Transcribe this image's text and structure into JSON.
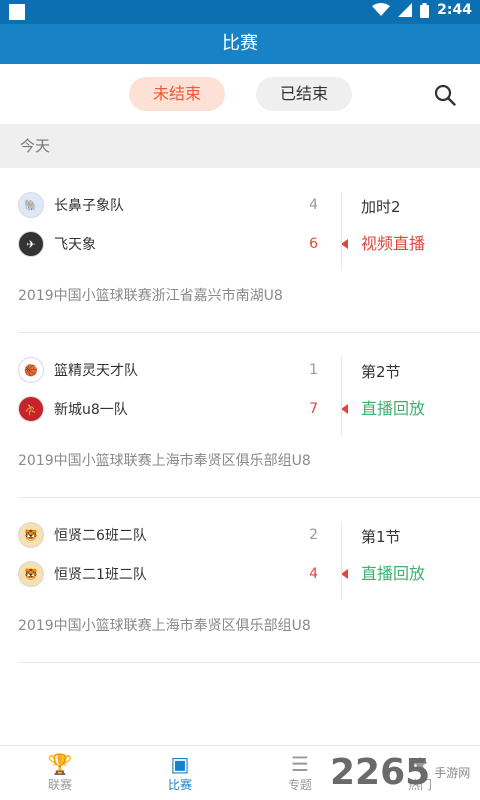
{
  "status_bar": {
    "time": "2:44"
  },
  "app_bar": {
    "title": "比赛"
  },
  "tabs": {
    "ongoing": "未结束",
    "finished": "已结束"
  },
  "day_header": "今天",
  "matches": [
    {
      "home": {
        "name": "长鼻子象队",
        "score": "4"
      },
      "away": {
        "name": "飞天象",
        "score": "6"
      },
      "status": "加时2",
      "live": "视频直播",
      "league": "2019中国小篮球联赛浙江省嘉兴市南湖U8"
    },
    {
      "home": {
        "name": "篮精灵天才队",
        "score": "1"
      },
      "away": {
        "name": "新城u8一队",
        "score": "7"
      },
      "status": "第2节",
      "live": "直播回放",
      "league": "2019中国小篮球联赛上海市奉贤区俱乐部组U8"
    },
    {
      "home": {
        "name": "恒贤二6班二队",
        "score": "2"
      },
      "away": {
        "name": "恒贤二1班二队",
        "score": "4"
      },
      "status": "第1节",
      "live": "直播回放",
      "league": "2019中国小篮球联赛上海市奉贤区俱乐部组U8"
    }
  ],
  "bottom_nav": [
    {
      "label": "联赛",
      "icon": "trophy-icon"
    },
    {
      "label": "比赛",
      "icon": "match-icon"
    },
    {
      "label": "专题",
      "icon": "topic-icon"
    },
    {
      "label": "热门",
      "icon": "hot-icon"
    }
  ],
  "watermark": {
    "number": "2265",
    "text": "手游网"
  },
  "colors": {
    "app_bar": "#1782c5",
    "accent": "#f05a33",
    "live_red": "#e0473c",
    "replay_green": "#3ab26e",
    "nav_active": "#1782c5"
  }
}
